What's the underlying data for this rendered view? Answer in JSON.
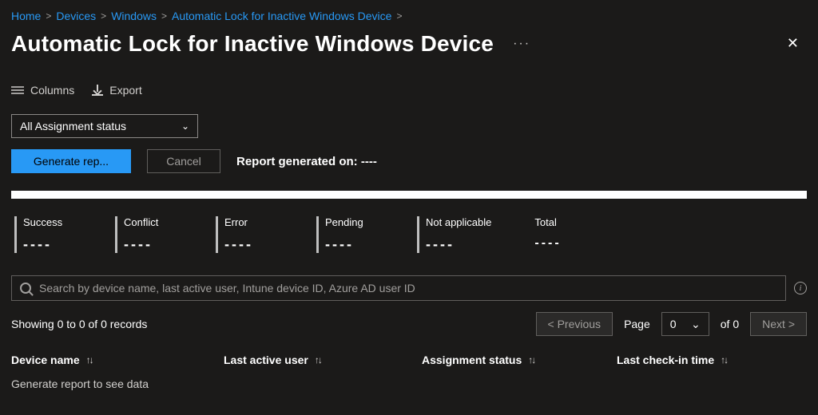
{
  "breadcrumb": {
    "items": [
      {
        "label": "Home"
      },
      {
        "label": "Devices"
      },
      {
        "label": "Windows"
      },
      {
        "label": "Automatic Lock for Inactive Windows Device"
      }
    ]
  },
  "title": "Automatic Lock for Inactive Windows Device",
  "toolbar": {
    "columns_label": "Columns",
    "export_label": "Export"
  },
  "filter": {
    "assignment_status_selected": "All Assignment status"
  },
  "actions": {
    "generate_label": "Generate rep...",
    "cancel_label": "Cancel",
    "report_generated_prefix": "Report generated on:",
    "report_generated_value": "----"
  },
  "metrics": [
    {
      "label": "Success",
      "value": "----"
    },
    {
      "label": "Conflict",
      "value": "----"
    },
    {
      "label": "Error",
      "value": "----"
    },
    {
      "label": "Pending",
      "value": "----"
    },
    {
      "label": "Not applicable",
      "value": "----"
    },
    {
      "label": "Total",
      "value": "----"
    }
  ],
  "search": {
    "placeholder": "Search by device name, last active user, Intune device ID, Azure AD user ID"
  },
  "pagination": {
    "records_text": "Showing 0 to 0 of 0 records",
    "previous_label": "<  Previous",
    "next_label": "Next  >",
    "page_label": "Page",
    "current_page": "0",
    "total_pages_prefix": "of",
    "total_pages": "0"
  },
  "table": {
    "columns": [
      "Device name",
      "Last active user",
      "Assignment status",
      "Last check-in time"
    ],
    "empty_message": "Generate report to see data"
  },
  "info_glyph": "i"
}
